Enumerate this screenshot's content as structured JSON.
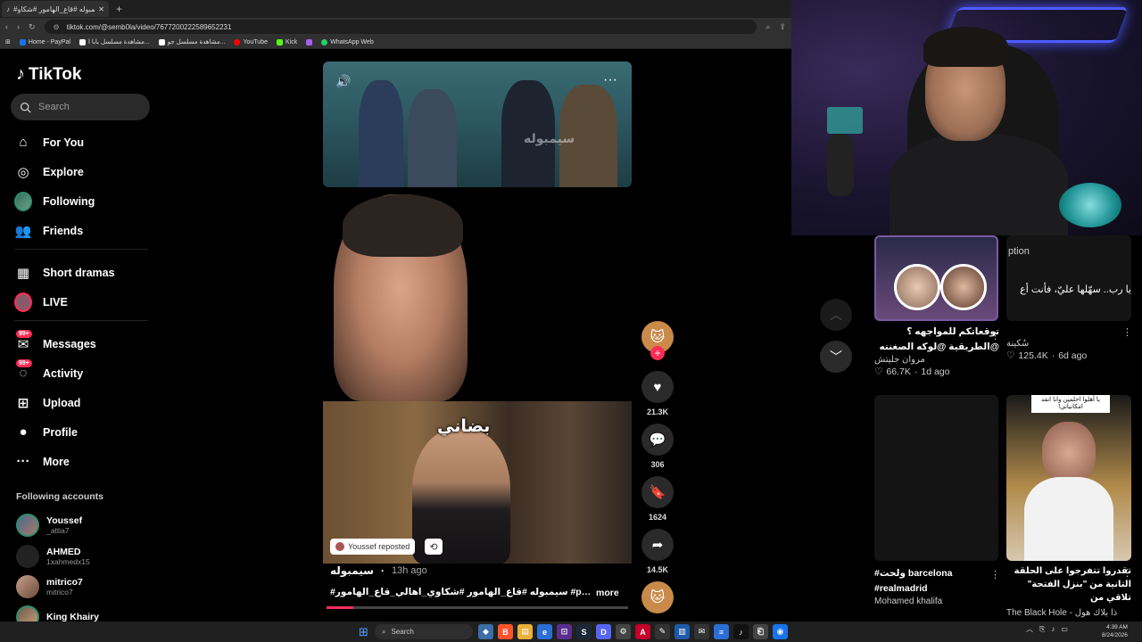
{
  "browser": {
    "tab_title": "#سيمبوله #قاع_الهامور #شكاو...",
    "url": "tiktok.com/@semb0la/video/7677200222589652231",
    "bookmarks": [
      "Home - PayPal",
      "مشاهدة مسلسل بابا ا...",
      "مشاهدة مسلسل جو...",
      "YouTube",
      "Kick",
      "WhatsApp Web"
    ]
  },
  "sidebar": {
    "logo": "TikTok",
    "search_placeholder": "Search",
    "nav": [
      {
        "label": "For You",
        "icon": "home-icon"
      },
      {
        "label": "Explore",
        "icon": "compass-icon"
      },
      {
        "label": "Following",
        "icon": "avatar-icon"
      },
      {
        "label": "Friends",
        "icon": "friends-icon"
      },
      {
        "label": "Short dramas",
        "icon": "film-icon"
      },
      {
        "label": "LIVE",
        "icon": "live-icon"
      },
      {
        "label": "Messages",
        "icon": "messages-icon",
        "badge": "99+"
      },
      {
        "label": "Activity",
        "icon": "activity-icon",
        "badge": "99+"
      },
      {
        "label": "Upload",
        "icon": "upload-icon"
      },
      {
        "label": "Profile",
        "icon": "profile-icon"
      },
      {
        "label": "More",
        "icon": "more-icon"
      }
    ],
    "following_heading": "Following accounts",
    "accounts": [
      {
        "name": "Youssef",
        "handle": "_attia7"
      },
      {
        "name": "AHMED",
        "handle": "1xahmedx15"
      },
      {
        "name": "mitrico7",
        "handle": "mitrico7"
      },
      {
        "name": "King Khairy",
        "handle": ""
      }
    ]
  },
  "feed": {
    "watermark": "سيمبوله",
    "subtitle": "بضاني",
    "repost_label": "Youssef reposted",
    "author": "سيمبوله",
    "time_ago": "13h ago",
    "caption": "#سيمبوله #قاع_الهامور #شكاوي_اهالي_قاع_الهامور #peterpark...",
    "more_label": "more",
    "progress": 0.09,
    "likes": "21.3K",
    "comments": "306",
    "saves": "1624",
    "shares": "14.5K"
  },
  "recommendations": [
    {
      "title": "توقعاتكم للمواجهه ؟ @الطريقية @لوكه الصغننه",
      "user": "مروان جليتش",
      "likes": "66.7K",
      "ago": "1d ago"
    },
    {
      "title": "ption",
      "overlay": "يا رب.. سهّلها عليّ، فأنت أع",
      "user": "سُكينة",
      "likes": "125.4K",
      "ago": "6d ago"
    },
    {
      "title": "#ولحت barcelona #realmadrid",
      "user": "Mohamed khalifa"
    },
    {
      "title": "تقدروا تتفرجوا على الحلقة التانية من \"بنزل الفتحة\" تلاقي من",
      "user": "The Black Hole - ذا بلاك هول",
      "overlay": "يا أهلوا احلمين وانا انقد امكانياتي!"
    }
  ],
  "taskbar": {
    "search_label": "Search",
    "time": "4:39 AM",
    "date": "8/24/2026"
  },
  "colors": {
    "accent": "#fe2c55",
    "background": "#000000",
    "neon": "#4d5bff"
  }
}
